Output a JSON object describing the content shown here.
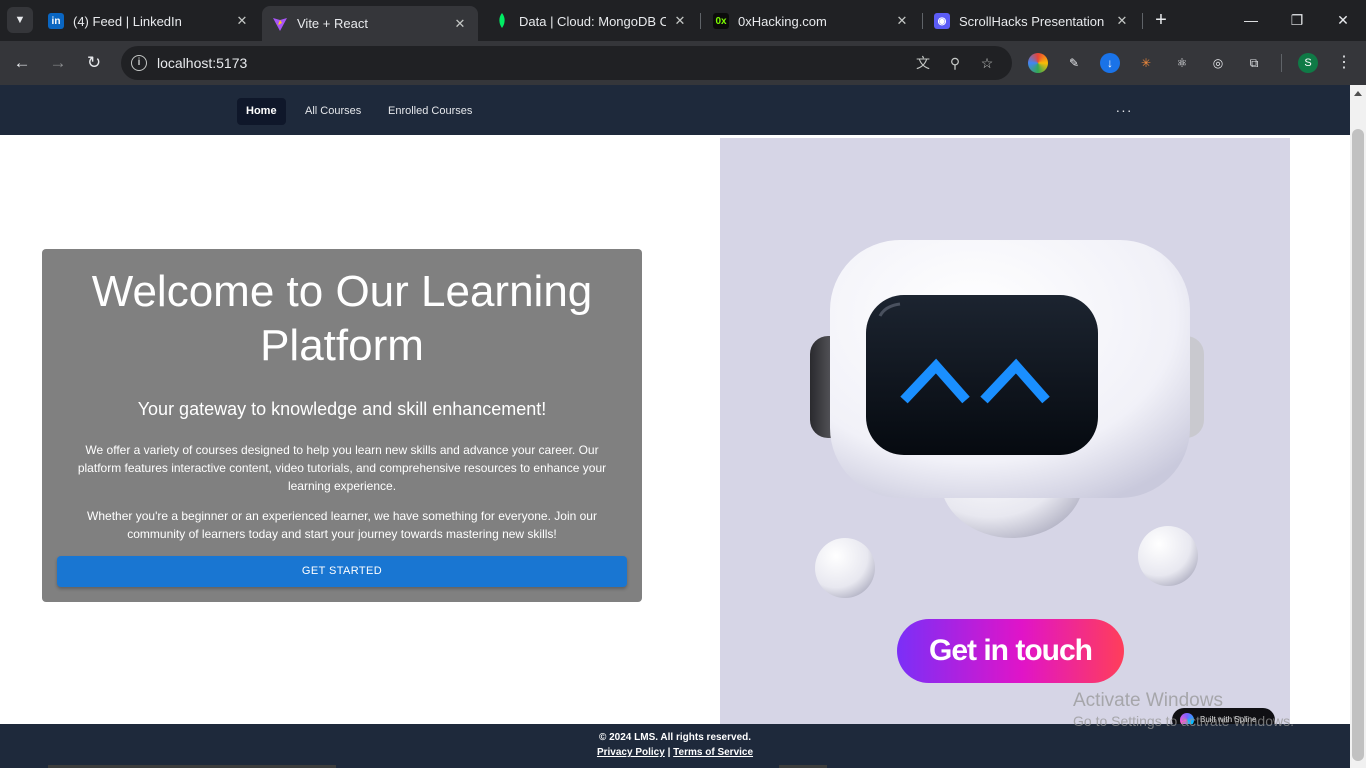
{
  "browser": {
    "tabs": [
      {
        "title": "(4) Feed | LinkedIn",
        "icon": "linkedin-icon",
        "active": false
      },
      {
        "title": "Vite + React",
        "icon": "vite-icon",
        "active": true
      },
      {
        "title": "Data | Cloud: MongoDB Clou",
        "icon": "mongodb-leaf-icon",
        "active": false
      },
      {
        "title": "0xHacking.com",
        "icon": "0x-icon",
        "active": false
      },
      {
        "title": "ScrollHacks Presentation For",
        "icon": "scrollhacks-icon",
        "active": false
      }
    ],
    "url": "localhost:5173",
    "profile_initial": "S",
    "favicon_text": {
      "linkedin": "in",
      "zerox": "0x"
    }
  },
  "app": {
    "nav": [
      {
        "label": "Home",
        "active": true
      },
      {
        "label": "All Courses",
        "active": false
      },
      {
        "label": "Enrolled Courses",
        "active": false
      }
    ],
    "more_label": "···"
  },
  "hero": {
    "title": "Welcome to Our Learning Platform",
    "subtitle": "Your gateway to knowledge and skill enhancement!",
    "paragraph1": "We offer a variety of courses designed to help you learn new skills and advance your career. Our platform features interactive content, video tutorials, and comprehensive resources to enhance your learning experience.",
    "paragraph2": "Whether you're a beginner or an experienced learner, we have something for everyone. Join our community of learners today and start your journey towards mastering new skills!",
    "cta_label": "GET STARTED"
  },
  "spline": {
    "contact_label": "Get in touch",
    "badge_label": "Built with Spline"
  },
  "footer": {
    "copyright": "© 2024 LMS. All rights reserved.",
    "privacy": "Privacy Policy",
    "separator": "|",
    "terms": "Terms of Service"
  },
  "watermark": {
    "line1": "Activate Windows",
    "line2": "Go to Settings to activate Windows."
  },
  "colors": {
    "appbar": "#1e293b",
    "hero_card": "#808080",
    "cta": "#1976d2",
    "spline_bg": "#d6d5e6",
    "robot_eyes": "#1a8fff"
  }
}
